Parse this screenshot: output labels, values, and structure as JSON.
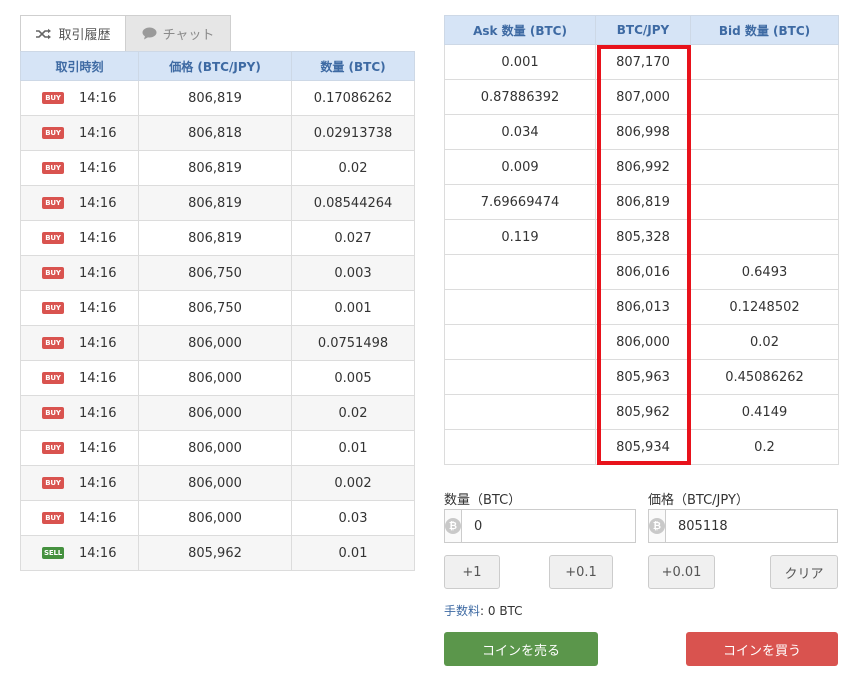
{
  "tabs": [
    {
      "label": "取引履歴",
      "icon": "shuffle-icon",
      "active": true
    },
    {
      "label": "チャット",
      "icon": "chat-bubble-icon",
      "active": false
    }
  ],
  "trade_history": {
    "headers": [
      "取引時刻",
      "価格 (BTC/JPY)",
      "数量 (BTC)"
    ],
    "rows": [
      {
        "side": "BUY",
        "time": "14:16",
        "price": "806,819",
        "amount": "0.17086262"
      },
      {
        "side": "BUY",
        "time": "14:16",
        "price": "806,818",
        "amount": "0.02913738"
      },
      {
        "side": "BUY",
        "time": "14:16",
        "price": "806,819",
        "amount": "0.02"
      },
      {
        "side": "BUY",
        "time": "14:16",
        "price": "806,819",
        "amount": "0.08544264"
      },
      {
        "side": "BUY",
        "time": "14:16",
        "price": "806,819",
        "amount": "0.027"
      },
      {
        "side": "BUY",
        "time": "14:16",
        "price": "806,750",
        "amount": "0.003"
      },
      {
        "side": "BUY",
        "time": "14:16",
        "price": "806,750",
        "amount": "0.001"
      },
      {
        "side": "BUY",
        "time": "14:16",
        "price": "806,000",
        "amount": "0.0751498"
      },
      {
        "side": "BUY",
        "time": "14:16",
        "price": "806,000",
        "amount": "0.005"
      },
      {
        "side": "BUY",
        "time": "14:16",
        "price": "806,000",
        "amount": "0.02"
      },
      {
        "side": "BUY",
        "time": "14:16",
        "price": "806,000",
        "amount": "0.01"
      },
      {
        "side": "BUY",
        "time": "14:16",
        "price": "806,000",
        "amount": "0.002"
      },
      {
        "side": "BUY",
        "time": "14:16",
        "price": "806,000",
        "amount": "0.03"
      },
      {
        "side": "SELL",
        "time": "14:16",
        "price": "805,962",
        "amount": "0.01"
      }
    ]
  },
  "order_book": {
    "headers": [
      "Ask 数量 (BTC)",
      "BTC/JPY",
      "Bid 数量 (BTC)"
    ],
    "rows": [
      {
        "ask": "0.001",
        "price": "807,170",
        "bid": "",
        "side": "ask"
      },
      {
        "ask": "0.87886392",
        "price": "807,000",
        "bid": "",
        "side": "ask"
      },
      {
        "ask": "0.034",
        "price": "806,998",
        "bid": "",
        "side": "ask"
      },
      {
        "ask": "0.009",
        "price": "806,992",
        "bid": "",
        "side": "ask"
      },
      {
        "ask": "7.69669474",
        "price": "806,819",
        "bid": "",
        "side": "ask"
      },
      {
        "ask": "0.119",
        "price": "805,328",
        "bid": "",
        "side": "ask"
      },
      {
        "ask": "",
        "price": "806,016",
        "bid": "0.6493",
        "side": "bid"
      },
      {
        "ask": "",
        "price": "806,013",
        "bid": "0.1248502",
        "side": "bid"
      },
      {
        "ask": "",
        "price": "806,000",
        "bid": "0.02",
        "side": "bid"
      },
      {
        "ask": "",
        "price": "805,963",
        "bid": "0.45086262",
        "side": "bid"
      },
      {
        "ask": "",
        "price": "805,962",
        "bid": "0.4149",
        "side": "bid"
      },
      {
        "ask": "",
        "price": "805,934",
        "bid": "0.2",
        "side": "bid"
      }
    ]
  },
  "order_form": {
    "amount_label": "数量（BTC）",
    "amount_value": "0",
    "price_label": "価格（BTC/JPY）",
    "price_value": "805118",
    "coin_icon": "bitcoin-icon",
    "coin_symbol": "₿",
    "step_buttons": [
      "+1",
      "+0.1",
      "+0.01"
    ],
    "clear_label": "クリア",
    "fee_label": "手数料",
    "fee_value": ": 0 BTC",
    "sell_label": "コインを売る",
    "buy_label": "コインを買う"
  },
  "colors": {
    "header_bg": "#d6e4f6",
    "header_text": "#3e6aa3",
    "ask_price": "#4f9a43",
    "bid_price": "#d9534f",
    "buy_badge": "#d9534f",
    "sell_badge": "#45913f",
    "highlight": "#e8121b",
    "sell_button": "#5b964b",
    "buy_button": "#d9534f"
  }
}
